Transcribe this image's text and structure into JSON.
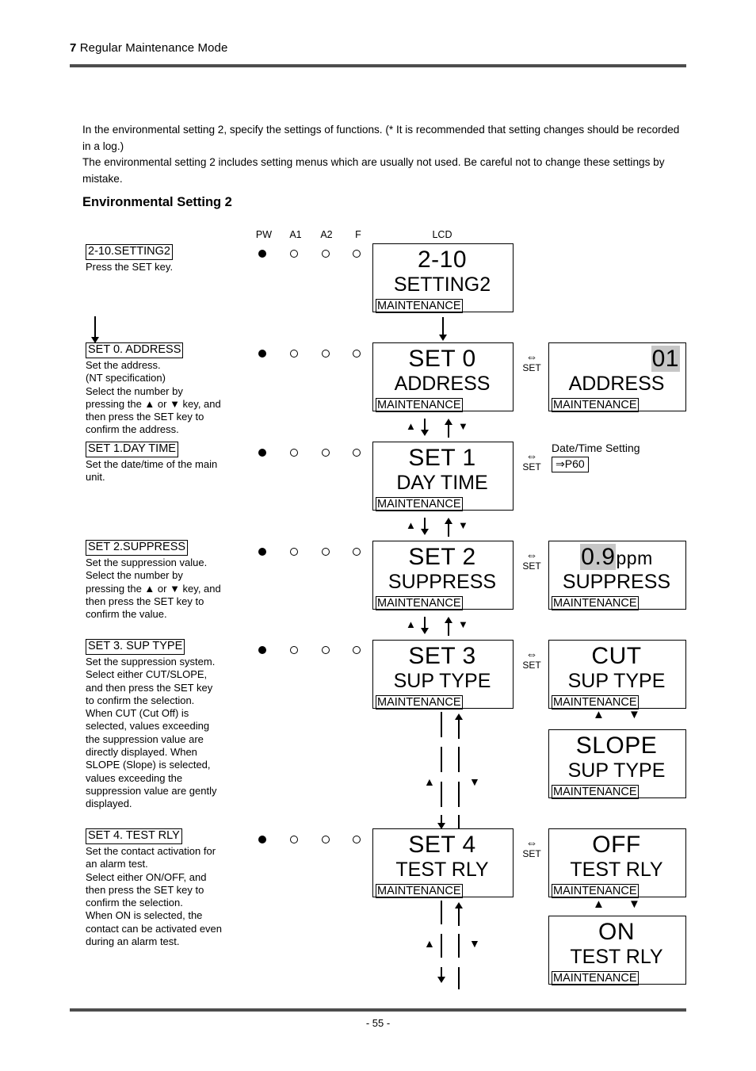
{
  "header": {
    "chapter_number": "7",
    "chapter_title": "Regular Maintenance Mode"
  },
  "intro": {
    "paragraph": "In the environmental setting 2, specify the settings of functions. (* It is recommended that setting changes should be recorded in a log.)\nThe environmental setting 2 includes setting menus which are usually not used. Be careful not to change these settings by mistake.",
    "section_title": "Environmental Setting 2"
  },
  "columns": {
    "pw": "PW",
    "a1": "A1",
    "a2": "A2",
    "f": "F",
    "lcd": "LCD"
  },
  "steps": [
    {
      "key": "setting2",
      "title": "2-10.SETTING2",
      "body": "Press the SET key.",
      "leds": [
        "on",
        "off",
        "off",
        "off"
      ],
      "lcd": {
        "line1": "2-10",
        "line2": "SETTING2",
        "line3": "MAINTENANCE"
      }
    },
    {
      "key": "set0",
      "title": "SET 0. ADDRESS",
      "body": "Set the address.\n(NT specification)\nSelect the number by\npressing the ▲ or ▼ key, and\nthen press the SET key to\nconfirm the address.",
      "leds": [
        "on",
        "off",
        "off",
        "off"
      ],
      "lcd": {
        "line1": "SET 0",
        "line2": "ADDRESS",
        "line3": "MAINTENANCE"
      },
      "set_label": "SET",
      "value_lcd": {
        "line1": "01",
        "line2": "ADDRESS",
        "line3": "MAINTENANCE",
        "highlight": "01"
      }
    },
    {
      "key": "set1",
      "title": "SET 1.DAY TIME",
      "body": "Set the date/time of the main\nunit.",
      "leds": [
        "on",
        "off",
        "off",
        "off"
      ],
      "lcd": {
        "line1": "SET 1",
        "line2": "DAY TIME",
        "line3": "MAINTENANCE"
      },
      "set_label": "SET",
      "reference": {
        "caption": "Date/Time Setting",
        "link": "⇒P60"
      }
    },
    {
      "key": "set2",
      "title": "SET 2.SUPPRESS",
      "body": "Set the suppression value.\nSelect the number by\npressing the ▲ or ▼ key, and\nthen press the SET key to\nconfirm the value.",
      "leds": [
        "on",
        "off",
        "off",
        "off"
      ],
      "lcd": {
        "line1": "SET 2",
        "line2": "SUPPRESS",
        "line3": "MAINTENANCE"
      },
      "set_label": "SET",
      "value_lcd": {
        "value": "0.9",
        "unit": "ppm",
        "line2": "SUPPRESS",
        "line3": "MAINTENANCE"
      }
    },
    {
      "key": "set3",
      "title": "SET 3. SUP TYPE",
      "body": "Set the suppression system.\nSelect either CUT/SLOPE,\nand then press the SET key\nto confirm the selection.\nWhen CUT (Cut Off) is\nselected, values exceeding\nthe suppression value are\ndirectly displayed. When\nSLOPE (Slope) is selected,\nvalues exceeding the\nsuppression value are gently\ndisplayed.",
      "leds": [
        "on",
        "off",
        "off",
        "off"
      ],
      "lcd": {
        "line1": "SET 3",
        "line2": "SUP TYPE",
        "line3": "MAINTENANCE"
      },
      "set_label": "SET",
      "value_lcd": {
        "line1": "CUT",
        "line2": "SUP TYPE",
        "line3": "MAINTENANCE"
      },
      "value_lcd_alt": {
        "line1": "SLOPE",
        "line2": "SUP TYPE",
        "line3": "MAINTENANCE"
      }
    },
    {
      "key": "set4",
      "title": "SET 4. TEST RLY",
      "body": "Set the contact activation for\nan alarm test.\nSelect either ON/OFF, and\nthen press the SET key to\nconfirm the selection.\nWhen ON is selected, the\ncontact can be activated even\nduring an alarm test.",
      "leds": [
        "on",
        "off",
        "off",
        "off"
      ],
      "lcd": {
        "line1": "SET 4",
        "line2": "TEST RLY",
        "line3": "MAINTENANCE"
      },
      "set_label": "SET",
      "value_lcd": {
        "line1": "OFF",
        "line2": "TEST RLY",
        "line3": "MAINTENANCE"
      },
      "value_lcd_alt": {
        "line1": "ON",
        "line2": "TEST RLY",
        "line3": "MAINTENANCE"
      }
    }
  ],
  "nav_glyphs": {
    "up": "▲",
    "down": "▼",
    "exchange": "⇔"
  },
  "footer": {
    "page_number": "- 55 -"
  },
  "colors": {
    "rule": "#4d4d4d",
    "highlight": "#c6c6c6",
    "ink": "#000000"
  }
}
